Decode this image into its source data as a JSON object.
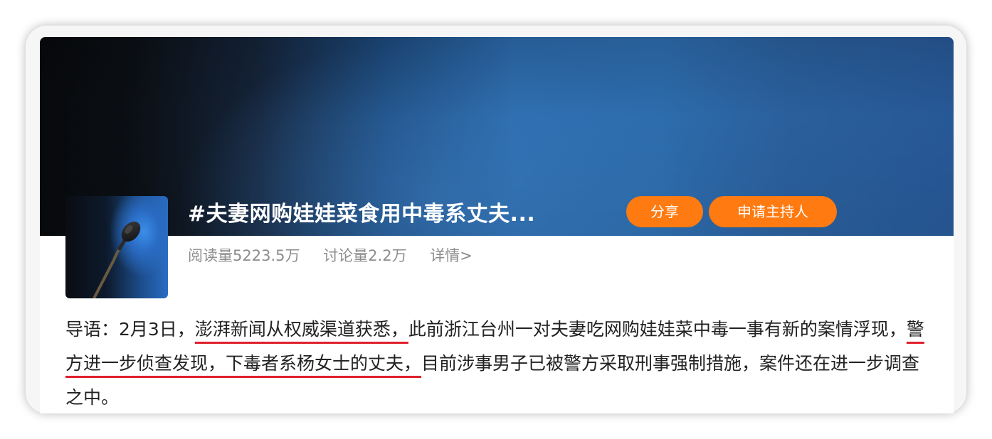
{
  "topic": {
    "title": "#夫妻网购娃娃菜食用中毒系丈夫...",
    "share_label": "分享",
    "apply_host_label": "申请主持人",
    "read_count": "阅读量5223.5万",
    "discussion_count": "讨论量2.2万",
    "details_link": "详情>"
  },
  "intro": {
    "part1": "导语：2月3日，",
    "highlight1": "澎湃新闻从权威渠道获悉，",
    "part2": "此前浙江台州一对夫妻吃网购娃娃菜中毒一事有新的案情浮现，",
    "highlight2": "警方进一步侦查发现，下毒者系杨女士的丈夫，",
    "part3": "目前涉事男子已被警方采取刑事强制措施，案件还在进一步调查之中。"
  },
  "colors": {
    "accent_button": "#ff7a10",
    "underline": "#e0202a",
    "stat_text": "#8c8c8c"
  },
  "icons": {
    "thumbnail": "microphone-image"
  }
}
